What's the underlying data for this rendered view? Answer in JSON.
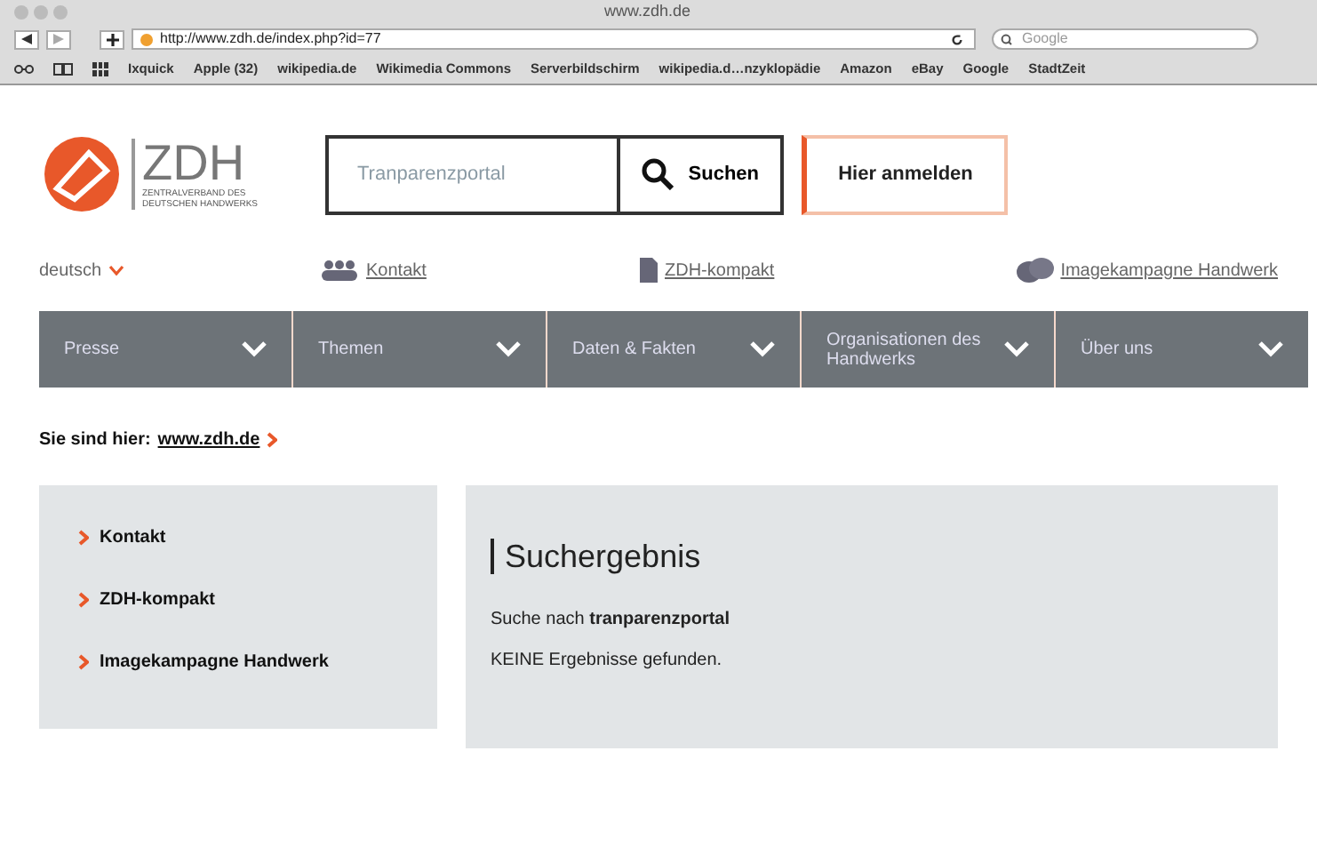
{
  "window": {
    "title": "www.zdh.de"
  },
  "toolbar": {
    "url": "http://www.zdh.de/index.php?id=77",
    "search_placeholder": "Google"
  },
  "bookmarks": [
    "Ixquick",
    "Apple (32)",
    "wikipedia.de",
    "Wikimedia Commons",
    "Serverbildschirm",
    "wikipedia.d…nzyklopädie",
    "Amazon",
    "eBay",
    "Google",
    "StadtZeit"
  ],
  "logo": {
    "name": "ZDH",
    "subtitle": "ZENTRALVERBAND DES DEUTSCHEN HANDWERKS"
  },
  "search": {
    "placeholder": "Tranparenzportal",
    "button": "Suchen"
  },
  "login": "Hier anmelden",
  "language": "deutsch",
  "top_links": [
    {
      "kind": "people",
      "label": "Kontakt"
    },
    {
      "kind": "document",
      "label": "ZDH-kompakt"
    },
    {
      "kind": "bubbles",
      "label": "Imagekampagne Handwerk"
    }
  ],
  "nav": [
    "Presse",
    "Themen",
    "Daten & Fakten",
    "Organisationen des Handwerks",
    "Über uns"
  ],
  "breadcrumb": {
    "label": "Sie sind hier:",
    "link": "www.zdh.de"
  },
  "sidebar": [
    "Kontakt",
    "ZDH-kompakt",
    "Imagekampagne Handwerk"
  ],
  "result": {
    "title": "Suchergebnis",
    "query_line": "Suche nach **tranparenzportal**",
    "message": "KEINE Ergebnisse gefunden."
  }
}
